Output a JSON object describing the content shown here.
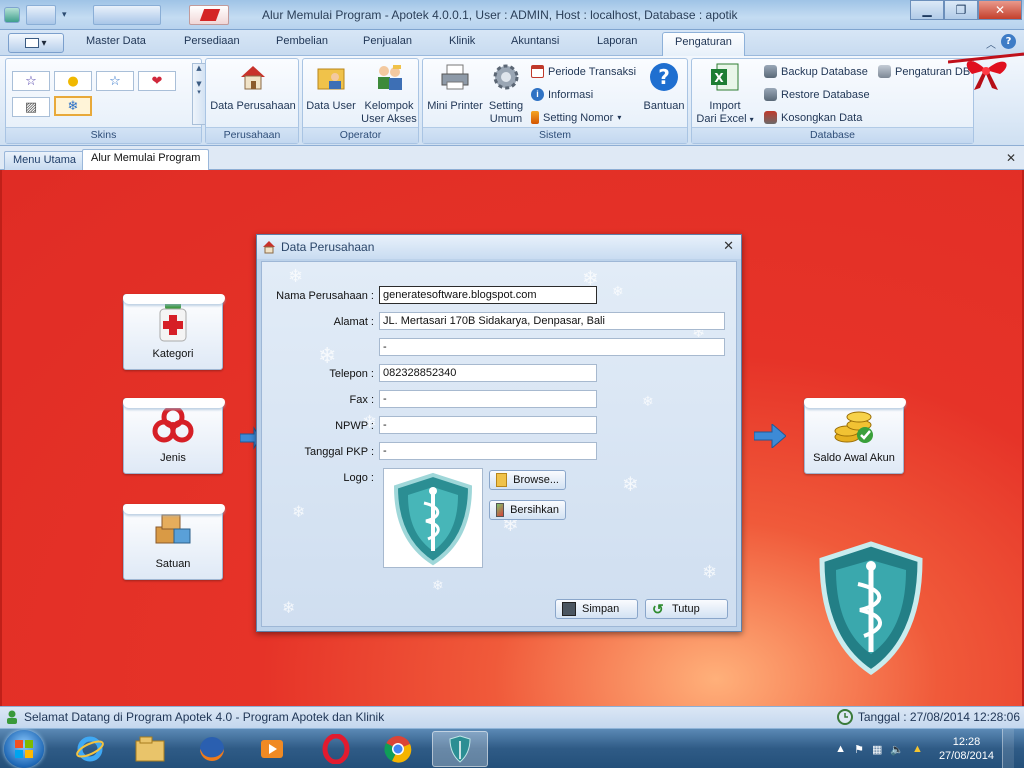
{
  "window": {
    "title": "Alur Memulai Program - Apotek 4.0.0.1,  User : ADMIN, Host : localhost, Database : apotik"
  },
  "ribbon_tabs": [
    "Master Data",
    "Persediaan",
    "Pembelian",
    "Penjualan",
    "Klinik",
    "Akuntansi",
    "Laporan",
    "Pengaturan"
  ],
  "ribbon": {
    "skins": {
      "label": "Skins"
    },
    "perusahaan": {
      "label": "Perusahaan",
      "data_perusahaan": "Data Perusahaan"
    },
    "operator": {
      "label": "Operator",
      "data_user": "Data User",
      "kelompok_line1": "Kelompok",
      "kelompok_line2": "User Akses"
    },
    "sistem": {
      "label": "Sistem",
      "mini_printer": "Mini Printer",
      "setting_line1": "Setting",
      "setting_line2": "Umum",
      "periode_transaksi": "Periode Transaksi",
      "informasi": "Informasi",
      "setting_nomor": "Setting Nomor",
      "bantuan": "Bantuan"
    },
    "database": {
      "label": "Database",
      "import_line1": "Import",
      "import_line2": "Dari Excel",
      "backup": "Backup Database",
      "restore": "Restore Database",
      "kosongkan": "Kosongkan Data",
      "pengaturan_db": "Pengaturan DB"
    }
  },
  "doc_tabs": [
    "Menu Utama",
    "Alur Memulai Program"
  ],
  "tiles": {
    "kategori": "Kategori",
    "jenis": "Jenis",
    "satuan": "Satuan",
    "saldo": "Saldo Awal Akun"
  },
  "dialog": {
    "title": "Data Perusahaan",
    "labels": {
      "nama": "Nama Perusahaan :",
      "alamat": "Alamat :",
      "telepon": "Telepon :",
      "fax": "Fax :",
      "npwp": "NPWP :",
      "tgl_pkp": "Tanggal PKP :",
      "logo": "Logo :"
    },
    "values": {
      "nama": "generatesoftware.blogspot.com",
      "alamat1": "JL. Mertasari 170B Sidakarya, Denpasar, Bali",
      "alamat2": "-",
      "telepon": "082328852340",
      "fax": "-",
      "npwp": "-",
      "tgl_pkp": "-"
    },
    "buttons": {
      "browse": "Browse...",
      "bersihkan": "Bersihkan",
      "simpan": "Simpan",
      "tutup": "Tutup"
    }
  },
  "status": {
    "welcome": "Selamat Datang di Program Apotek  4.0 - Program Apotek dan Klinik",
    "tanggal": "Tanggal : 27/08/2014 12:28:06"
  },
  "taskbar": {
    "time": "12:28",
    "date": "27/08/2014"
  },
  "colors": {
    "canvas_red": "#e02c25",
    "ribbon_blue": "#dbe8f6",
    "shield_teal": "#2a9a9a"
  }
}
